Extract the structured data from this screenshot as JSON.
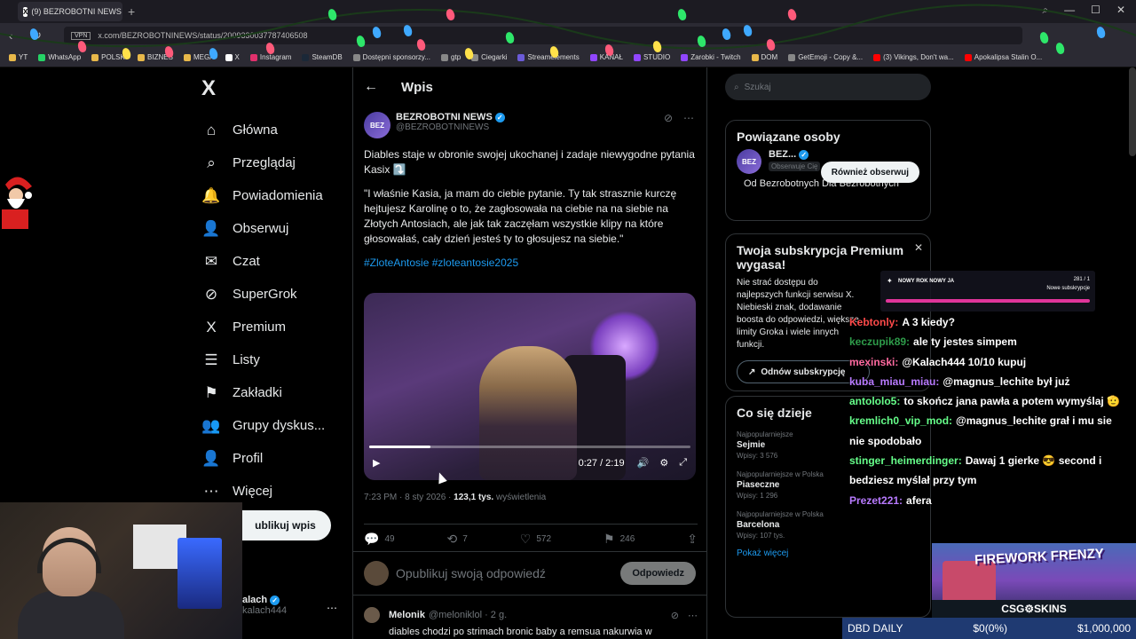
{
  "browser": {
    "tab_title": "(9) BEZROBOTNI NEWS",
    "tab_icon": "X",
    "url": "x.com/BEZROBOTNINEWS/status/2009330037787406508",
    "vpn": "VPN",
    "bookmarks": [
      "YT",
      "WhatsApp",
      "POLSKI",
      "BIZNES",
      "MEGA",
      "X",
      "Instagram",
      "SteamDB",
      "Dostępni sponsorzy...",
      "gtp",
      "Ciegarki",
      "Streamelements",
      "KANAŁ",
      "STUDIO",
      "Zarobki - Twitch",
      "DOM",
      "GetEmoji - Copy &...",
      "(3) Vikings, Don't wa...",
      "Apokalipsa Stalin O..."
    ]
  },
  "nav": {
    "logo": "X",
    "items": [
      {
        "label": "Główna",
        "icon": "⌂"
      },
      {
        "label": "Przeglądaj",
        "icon": "⌕"
      },
      {
        "label": "Powiadomienia",
        "icon": "🔔"
      },
      {
        "label": "Obserwuj",
        "icon": "👤"
      },
      {
        "label": "Czat",
        "icon": "✉"
      },
      {
        "label": "SuperGrok",
        "icon": "⊘"
      },
      {
        "label": "Premium",
        "icon": "X"
      },
      {
        "label": "Listy",
        "icon": "☰"
      },
      {
        "label": "Zakładki",
        "icon": "⚑"
      },
      {
        "label": "Grupy dyskus...",
        "icon": "👥"
      },
      {
        "label": "Profil",
        "icon": "👤"
      },
      {
        "label": "Więcej",
        "icon": "⋯"
      }
    ],
    "post_button": "ublikuj wpis",
    "profile_name": "alach",
    "profile_handle": "kalach444"
  },
  "main": {
    "header": "Wpis",
    "author_name": "BEZROBOTNI NEWS",
    "author_handle": "@BEZROBOTNINEWS",
    "avatar_text": "BEZ",
    "text_p1": "Diables staje w obronie swojej ukochanej i zadaje niewygodne pytania Kasix ⤵️",
    "text_p2": "\"I właśnie Kasia, ja mam do ciebie pytanie. Ty tak strasznie kurczę hejtujesz Karolinę o to, że zagłosowała na ciebie na na siebie na Złotych Antosiach, ale jak tak zaczęłam wszystkie klipy na które głosowałaś, cały dzień jesteś ty to głosujesz na siebie.\"",
    "hashtags": "#ZloteAntosie #zloteantosie2025",
    "video_time": "0:27 / 2:19",
    "video_progress": 0.19,
    "meta_time": "7:23 PM · 8 sty 2026 · ",
    "meta_views": "123,1 tys.",
    "meta_views_label": " wyświetlenia",
    "replies": "49",
    "reposts": "7",
    "likes": "572",
    "bookmarks": "246",
    "reply_placeholder": "Opublikuj swoją odpowiedź",
    "reply_button": "Odpowiedz",
    "reply2": {
      "name": "Melonik",
      "handle": "@meloniklol · 2 g.",
      "text": "diables chodzi po strimach bronic baby a remsua nakurwia w"
    }
  },
  "right": {
    "search_placeholder": "Szukaj",
    "related_title": "Powiązane osoby",
    "related_name": "BEZ...",
    "related_sub": "Obserwuje Cię",
    "related_follow": "Również obserwuj",
    "related_bio": "Od Bezrobotnych Dla Bezrobotnych",
    "premium_title": "Twoja subskrypcja Premium wygasa!",
    "premium_text": "Nie strać dostępu do najlepszych funkcji serwisu X. Niebieski znak, dodawanie boosta do odpowiedzi, większe limity Groka i wiele innych funkcji.",
    "premium_button": "Odnów subskrypcję",
    "trends_title": "Co się dzieje",
    "trends": [
      {
        "cat": "Najpopularniejsze",
        "name": "Sejmie",
        "count": "Wpisy: 3 576"
      },
      {
        "cat": "Najpopularniejsze w Polska",
        "name": "Piaseczne",
        "count": "Wpisy: 1 296"
      },
      {
        "cat": "Najpopularniejsze w Polska",
        "name": "Barcelona",
        "count": "Wpisy: 107 tys."
      }
    ],
    "show_more": "Pokaż więcej"
  },
  "overlay": {
    "alert_title": "NOWY ROK NOWY JA",
    "alert_count": "281 / 1",
    "alert_sub": "Nowe subskrypcje",
    "chat": [
      {
        "user": "Kebtonly:",
        "color": "#ff4a4a",
        "text": "A 3 kiedy?"
      },
      {
        "user": "keczupik89:",
        "color": "#2e9c4a",
        "text": "ale ty jestes simpem"
      },
      {
        "user": "mexinski:",
        "color": "#ff6aa0",
        "text": "@Kalach444 10/10 kupuj"
      },
      {
        "user": "kuba_miau_miau:",
        "color": "#b87aff",
        "text": "@magnus_lechite był już"
      },
      {
        "user": "antololo5:",
        "color": "#66ff8a",
        "text": "to skończ jana pawła a potem wymyślaj 🫡"
      },
      {
        "user": "kremlich0_vip_mod:",
        "color": "#66ff8a",
        "text": "@magnus_lechite grał i mu sie nie spodobało"
      },
      {
        "user": "stinger_heimerdinger:",
        "color": "#66ff8a",
        "text": "Dawaj 1 gierke 😎 second i bedziesz myślał przy tym"
      },
      {
        "user": "Prezet221:",
        "color": "#b87aff",
        "text": "afera"
      }
    ],
    "game_title": "FIREWORK FRENZY",
    "game_sponsor": "CSG⚙SKINS",
    "bottom_left": "DBD DAILY",
    "bottom_mid": "$0(0%)",
    "bottom_right": "$1,000,000"
  }
}
